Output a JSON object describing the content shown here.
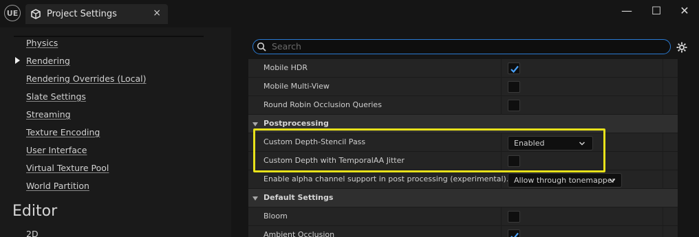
{
  "window": {
    "app_logo": "UE",
    "tab_title": "Project Settings",
    "tab_close": "×",
    "controls": {
      "minimize": "—",
      "maximize": "☐",
      "close": "✕"
    }
  },
  "sidebar": {
    "items": [
      {
        "label": "Physics"
      },
      {
        "label": "Rendering",
        "selected": true
      },
      {
        "label": "Rendering Overrides (Local)"
      },
      {
        "label": "Slate Settings"
      },
      {
        "label": "Streaming"
      },
      {
        "label": "Texture Encoding"
      },
      {
        "label": "User Interface"
      },
      {
        "label": "Virtual Texture Pool"
      },
      {
        "label": "World Partition"
      }
    ],
    "section_title": "Editor",
    "section_items": [
      {
        "label": "2D"
      }
    ]
  },
  "search": {
    "placeholder": "Search"
  },
  "properties": {
    "row_mobile_hdr": {
      "label": "Mobile HDR",
      "checked": true
    },
    "row_mobile_multiview": {
      "label": "Mobile Multi-View",
      "checked": false
    },
    "row_round_robin": {
      "label": "Round Robin Occlusion Queries",
      "checked": false
    },
    "cat_postprocessing": "Postprocessing",
    "row_custom_depth": {
      "label": "Custom Depth-Stencil Pass",
      "value": "Enabled"
    },
    "row_custom_depth_jitter": {
      "label": "Custom Depth with TemporalAA Jitter",
      "checked": false
    },
    "row_alpha_channel": {
      "label": "Enable alpha channel support in post processing (experimental).",
      "value": "Allow through tonemapper"
    },
    "cat_default_settings": "Default Settings",
    "row_bloom": {
      "label": "Bloom",
      "checked": false
    },
    "row_ambient_occlusion": {
      "label": "Ambient Occlusion",
      "checked": true
    }
  },
  "colors": {
    "accent": "#2a7bd4",
    "highlight": "#e8e21a",
    "check": "#4aa3ff"
  }
}
